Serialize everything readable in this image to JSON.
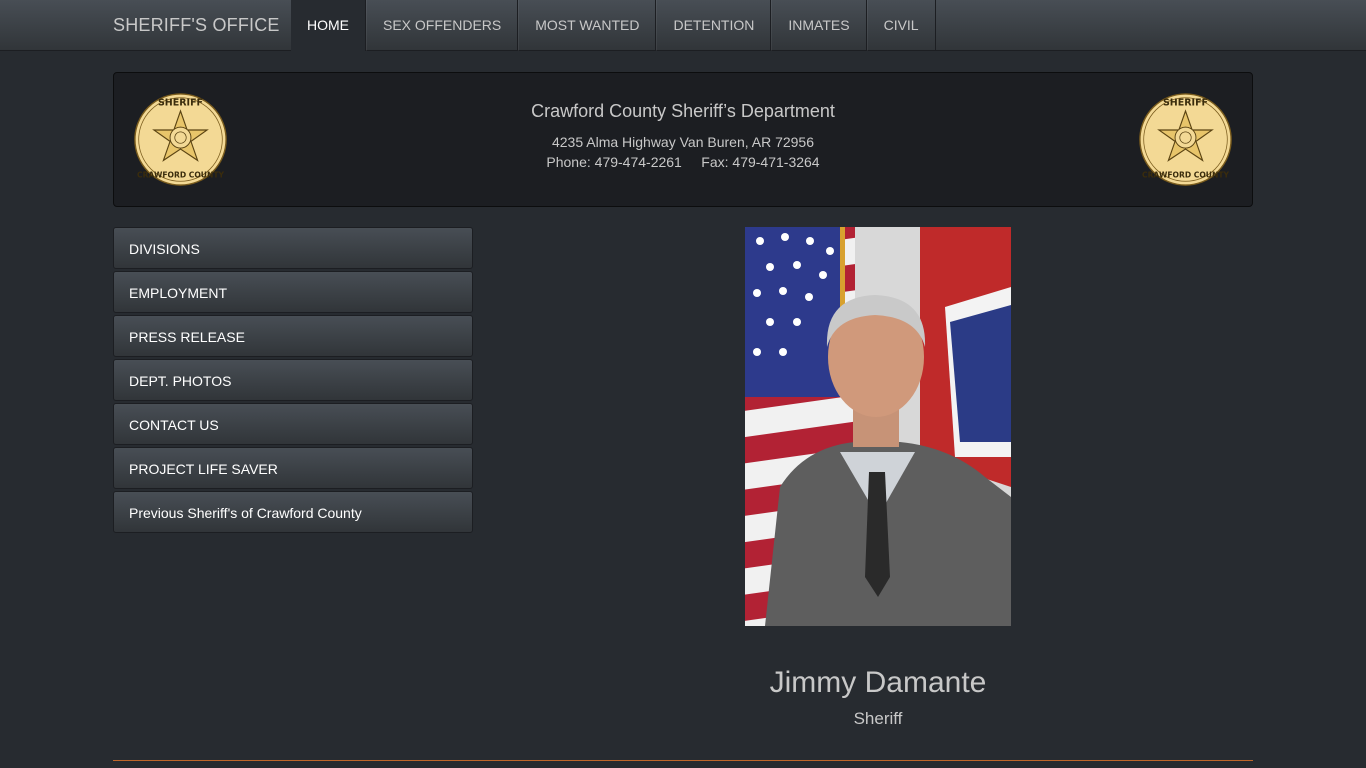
{
  "navbar": {
    "brand": "SHERIFF'S OFFICE",
    "items": [
      "HOME",
      "SEX OFFENDERS",
      "MOST WANTED",
      "DETENTION",
      "INMATES",
      "CIVIL"
    ],
    "active": "HOME"
  },
  "header": {
    "title": "Crawford County Sheriff’s Department",
    "address": "4235 Alma Highway Van Buren, AR 72956",
    "phone": "Phone: 479-474-2261     Fax: 479-471-3264",
    "badge_text_top": "SHERIFF",
    "badge_text_bottom": "CRAWFORD COUNTY",
    "badge_color": "#f3d995"
  },
  "side_menu": {
    "items": [
      "DIVISIONS",
      "EMPLOYMENT",
      "PRESS RELEASE",
      "DEPT. PHOTOS",
      "CONTACT US",
      "PROJECT LIFE SAVER",
      "Previous Sheriff's of Crawford County"
    ]
  },
  "sheriff": {
    "name": "Jimmy Damante",
    "title": "Sheriff"
  },
  "colors": {
    "background": "#272b30",
    "panel": "#1c1e22",
    "accent_line": "#c0672b"
  }
}
